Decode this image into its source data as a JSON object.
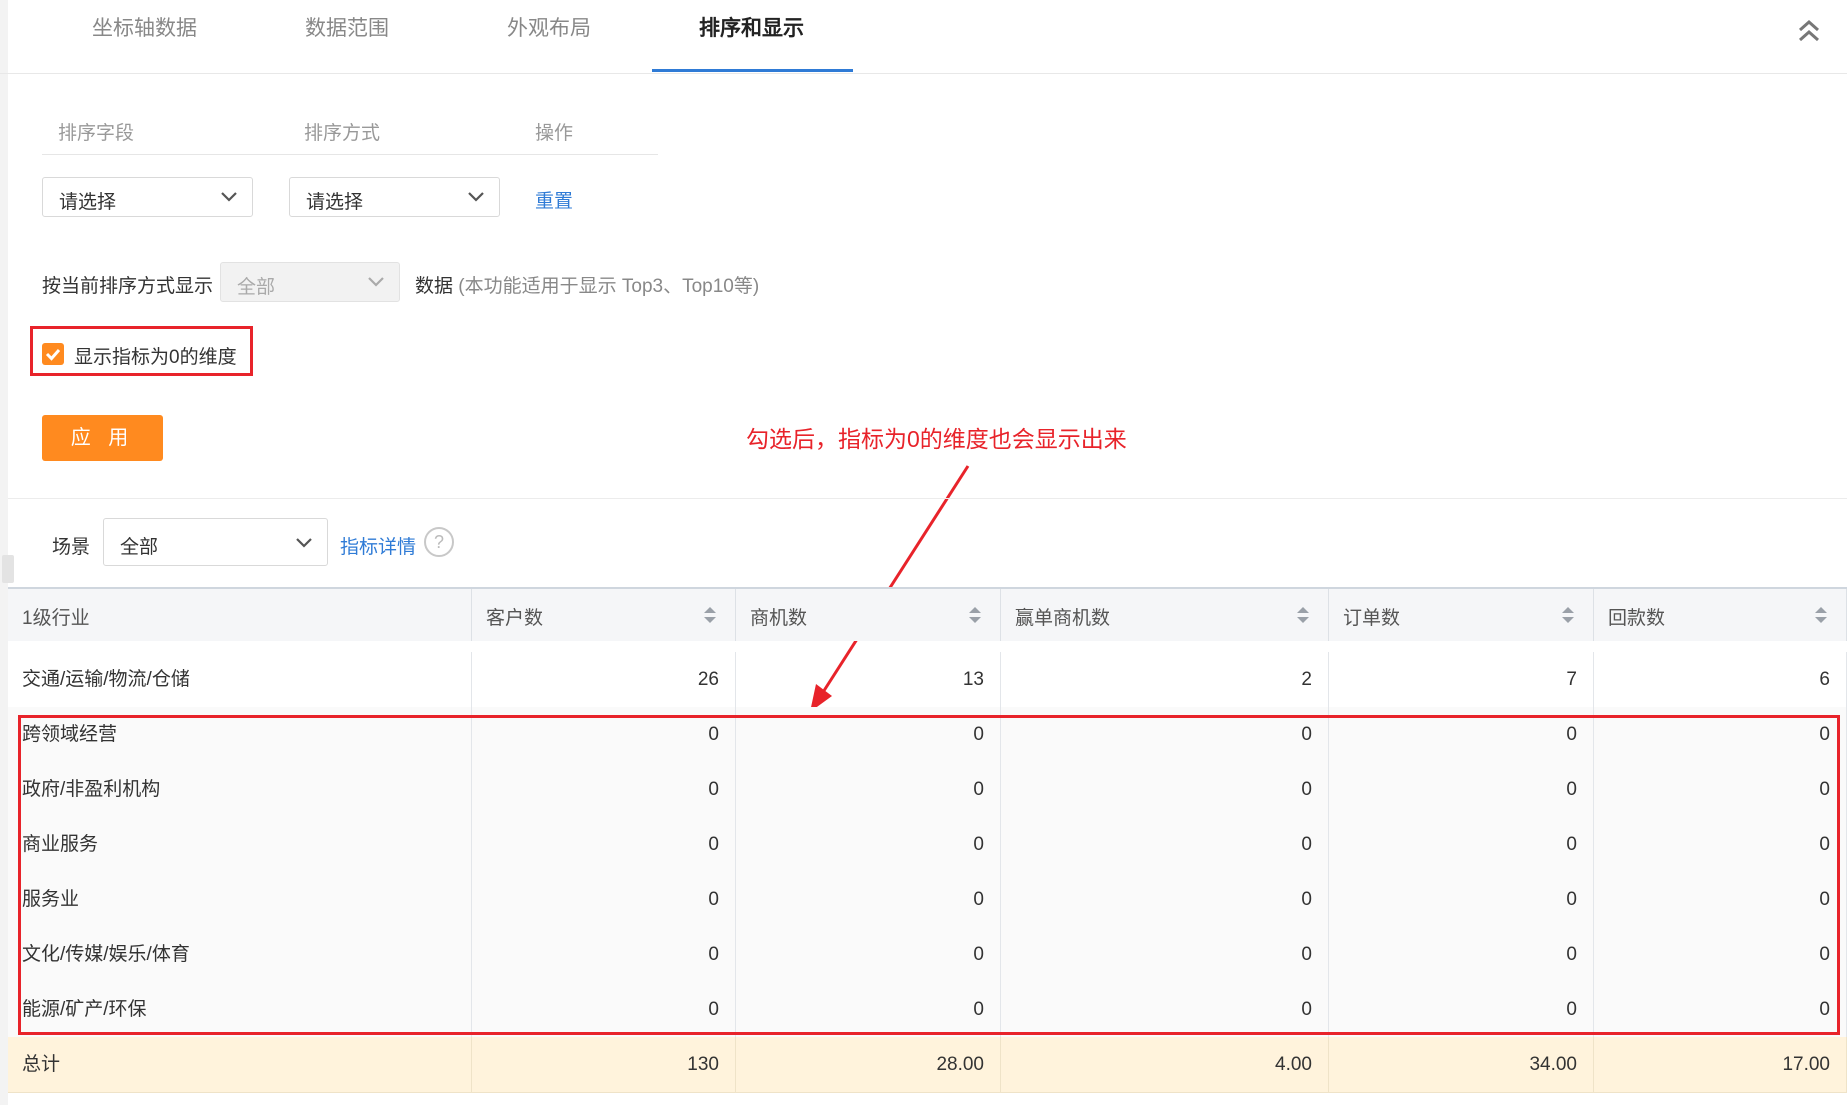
{
  "tabs": [
    {
      "label": "坐标轴数据"
    },
    {
      "label": "数据范围"
    },
    {
      "label": "外观布局"
    },
    {
      "label": "排序和显示"
    }
  ],
  "sort": {
    "headers": {
      "field": "排序字段",
      "method": "排序方式",
      "action": "操作"
    },
    "field_select": "请选择",
    "method_select": "请选择",
    "reset_label": "重置"
  },
  "topn": {
    "prefix": "按当前排序方式显示",
    "select_value": "全部",
    "suffix_main": "数据",
    "suffix_note": "(本功能适用于显示 Top3、Top10等)"
  },
  "checkbox": {
    "label": "显示指标为0的维度",
    "checked": true
  },
  "apply_label": "应 用",
  "annotation": "勾选后，指标为0的维度也会显示出来",
  "scene": {
    "label": "场景",
    "select_value": "全部",
    "detail_link": "指标详情",
    "help": "?"
  },
  "table": {
    "columns": [
      "1级行业",
      "客户数",
      "商机数",
      "赢单商机数",
      "订单数",
      "回款数"
    ],
    "rows": [
      [
        "交通/运输/物流/仓储",
        "26",
        "13",
        "2",
        "7",
        "6"
      ],
      [
        "跨领域经营",
        "0",
        "0",
        "0",
        "0",
        "0"
      ],
      [
        "政府/非盈利机构",
        "0",
        "0",
        "0",
        "0",
        "0"
      ],
      [
        "商业服务",
        "0",
        "0",
        "0",
        "0",
        "0"
      ],
      [
        "服务业",
        "0",
        "0",
        "0",
        "0",
        "0"
      ],
      [
        "文化/传媒/娱乐/体育",
        "0",
        "0",
        "0",
        "0",
        "0"
      ],
      [
        "能源/矿产/环保",
        "0",
        "0",
        "0",
        "0",
        "0"
      ]
    ],
    "total": [
      "总计",
      "130",
      "28.00",
      "4.00",
      "34.00",
      "17.00"
    ]
  },
  "colors": {
    "accent": "#ff8a1f",
    "link": "#2f7bd6",
    "annotation": "#e8232a",
    "total_row": "#fff3dc"
  }
}
